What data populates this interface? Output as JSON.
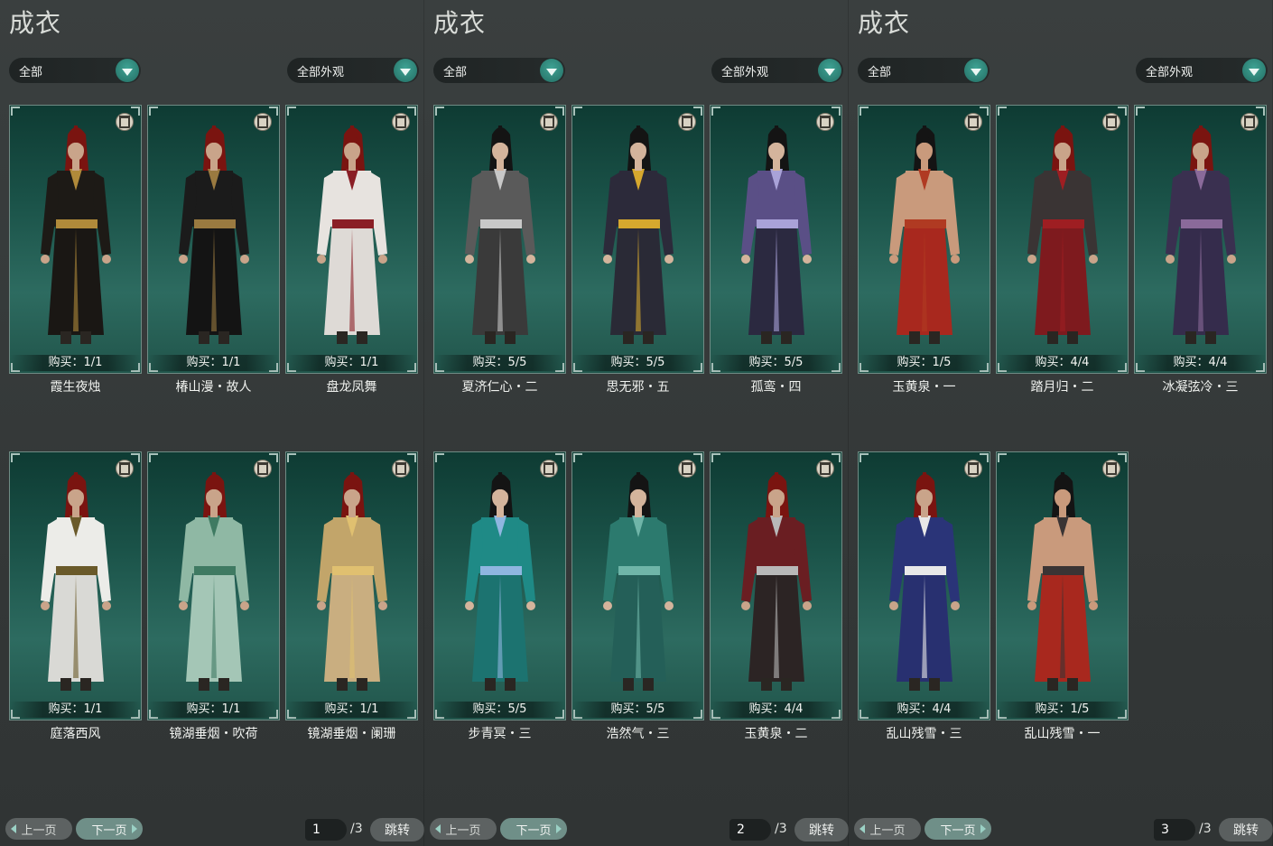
{
  "panels": [
    {
      "title": "成衣",
      "filter_category": "全部",
      "filter_appearance": "全部外观",
      "items": [
        {
          "purchase": "购买：1/1",
          "name": "霞生夜烛",
          "hair": "#7a1410",
          "top": "#1d1a16",
          "accent": "#b08a3a",
          "bottom": "#1a1714",
          "skin": "#c9a48a"
        },
        {
          "purchase": "购买：1/1",
          "name": "椿山漫・故人",
          "hair": "#7a1410",
          "top": "#1b1b1b",
          "accent": "#9a7a40",
          "bottom": "#141414",
          "skin": "#c9a48a"
        },
        {
          "purchase": "购买：1/1",
          "name": "盘龙凤舞",
          "hair": "#7a1410",
          "top": "#e7e3df",
          "accent": "#8a1f26",
          "bottom": "#dedad6",
          "skin": "#c9a48a"
        },
        {
          "purchase": "购买：1/1",
          "name": "庭落西风",
          "hair": "#7a1410",
          "top": "#ecece8",
          "accent": "#6a5a2a",
          "bottom": "#d9d9d5",
          "skin": "#c9a48a"
        },
        {
          "purchase": "购买：1/1",
          "name": "镜湖垂烟・吹荷",
          "hair": "#7a1410",
          "top": "#8fb8a4",
          "accent": "#3f7a62",
          "bottom": "#a4c6b6",
          "skin": "#c9a48a"
        },
        {
          "purchase": "购买：1/1",
          "name": "镜湖垂烟・阑珊",
          "hair": "#7a1410",
          "top": "#c2a56a",
          "accent": "#e0c070",
          "bottom": "#c9ae80",
          "skin": "#c9a48a"
        }
      ],
      "pager": {
        "prev": "上一页",
        "next": "下一页",
        "page": "1",
        "total": "/3",
        "jump": "跳转"
      }
    },
    {
      "title": "成衣",
      "filter_category": "全部",
      "filter_appearance": "全部外观",
      "items": [
        {
          "purchase": "购买：5/5",
          "name": "夏济仁心・二",
          "hair": "#141414",
          "top": "#5a5a5a",
          "accent": "#c8c8c8",
          "bottom": "#3a3a3a",
          "skin": "#d4b49c"
        },
        {
          "purchase": "购买：5/5",
          "name": "思无邪・五",
          "hair": "#141414",
          "top": "#2c2a3a",
          "accent": "#d6a82e",
          "bottom": "#2a2a36",
          "skin": "#d4b49c"
        },
        {
          "purchase": "购买：5/5",
          "name": "孤鸾・四",
          "hair": "#141414",
          "top": "#5a4f86",
          "accent": "#a9a2d8",
          "bottom": "#2b2940",
          "skin": "#d4b49c"
        },
        {
          "purchase": "购买：5/5",
          "name": "步青冥・三",
          "hair": "#141414",
          "top": "#1f8a86",
          "accent": "#8fb6e0",
          "bottom": "#1c7370",
          "skin": "#d4b49c"
        },
        {
          "purchase": "购买：5/5",
          "name": "浩然气・三",
          "hair": "#141414",
          "top": "#2c7a6e",
          "accent": "#6fb5a8",
          "bottom": "#245f58",
          "skin": "#d4b49c"
        },
        {
          "purchase": "购买：4/4",
          "name": "玉黄泉・二",
          "hair": "#7a1410",
          "top": "#6a1e22",
          "accent": "#b8b8b8",
          "bottom": "#2c2424",
          "skin": "#c9a48a"
        }
      ],
      "pager": {
        "prev": "上一页",
        "next": "下一页",
        "page": "2",
        "total": "/3",
        "jump": "跳转"
      }
    },
    {
      "title": "成衣",
      "filter_category": "全部",
      "filter_appearance": "全部外观",
      "items": [
        {
          "purchase": "购买：1/5",
          "name": "玉黄泉・一",
          "hair": "#141414",
          "top": "#c99a7c",
          "accent": "#b03a22",
          "bottom": "#a8281e",
          "skin": "#c99a7c"
        },
        {
          "purchase": "购买：4/4",
          "name": "踏月归・二",
          "hair": "#7a1410",
          "top": "#3a3434",
          "accent": "#9e1e22",
          "bottom": "#7e1a1e",
          "skin": "#c9a48a"
        },
        {
          "purchase": "购买：4/4",
          "name": "冰凝弦冷・三",
          "hair": "#7a1410",
          "top": "#3a3050",
          "accent": "#8a6a9a",
          "bottom": "#352c4c",
          "skin": "#c9a48a"
        },
        {
          "purchase": "购买：4/4",
          "name": "乱山残雪・三",
          "hair": "#7a1410",
          "top": "#2a3478",
          "accent": "#e8e8e8",
          "bottom": "#283070",
          "skin": "#c9a48a"
        },
        {
          "purchase": "购买：1/5",
          "name": "乱山残雪・一",
          "hair": "#141414",
          "top": "#c99a7c",
          "accent": "#3a3434",
          "bottom": "#a8281e",
          "skin": "#c99a7c"
        }
      ],
      "pager": {
        "prev": "上一页",
        "next": "下一页",
        "page": "3",
        "total": "/3",
        "jump": "跳转"
      }
    }
  ]
}
